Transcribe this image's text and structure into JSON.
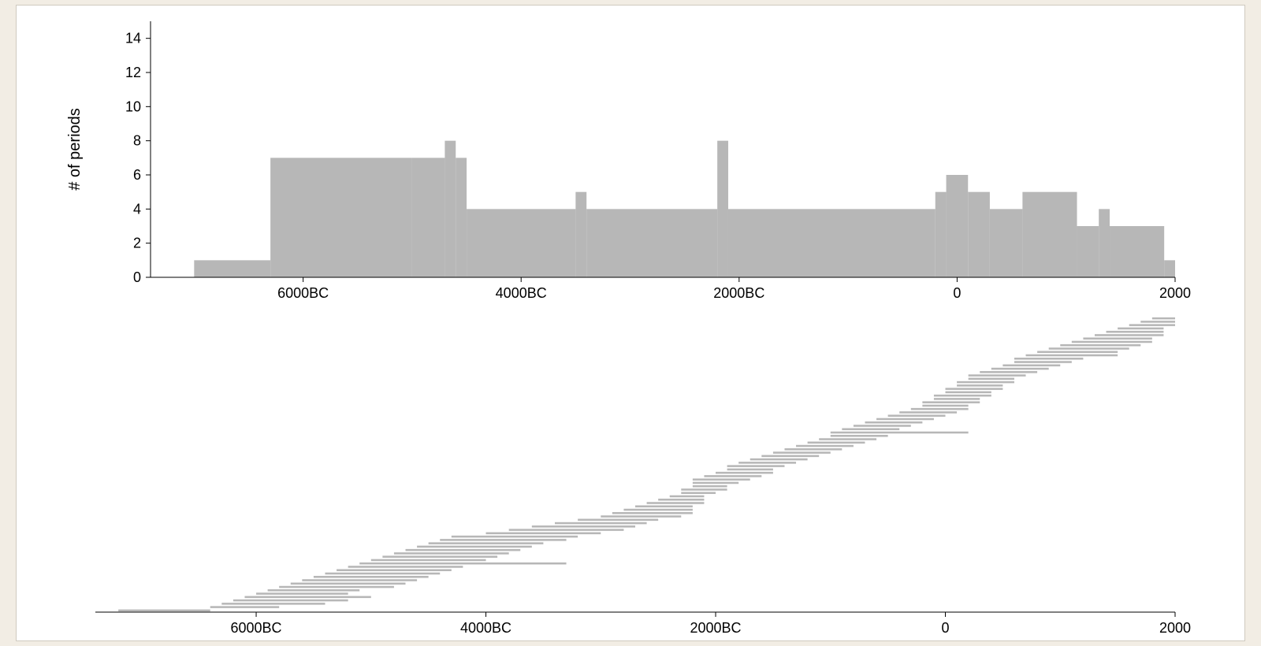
{
  "chart_data": [
    {
      "type": "bar",
      "title": "",
      "xlabel": "",
      "ylabel": "# of periods",
      "xlim": [
        -7400,
        2000
      ],
      "ylim": [
        0,
        15
      ],
      "x_ticks": [
        -6000,
        -4000,
        -2000,
        0,
        2000
      ],
      "x_tick_labels": [
        "6000BC",
        "4000BC",
        "2000BC",
        "0",
        "2000"
      ],
      "y_ticks": [
        0,
        2,
        4,
        6,
        8,
        10,
        12,
        14
      ],
      "bin_width": 100,
      "bins": [
        {
          "x0": -7000,
          "x1": -6300,
          "y": 1
        },
        {
          "x0": -6300,
          "x1": -5000,
          "y": 7
        },
        {
          "x0": -5000,
          "x1": -4700,
          "y": 7
        },
        {
          "x0": -4700,
          "x1": -4600,
          "y": 8
        },
        {
          "x0": -4600,
          "x1": -4500,
          "y": 7
        },
        {
          "x0": -4500,
          "x1": -3500,
          "y": 4
        },
        {
          "x0": -3500,
          "x1": -3400,
          "y": 5
        },
        {
          "x0": -3400,
          "x1": -2200,
          "y": 4
        },
        {
          "x0": -2200,
          "x1": -2100,
          "y": 8
        },
        {
          "x0": -2100,
          "x1": -200,
          "y": 4
        },
        {
          "x0": -200,
          "x1": -100,
          "y": 5
        },
        {
          "x0": -100,
          "x1": 100,
          "y": 6
        },
        {
          "x0": 100,
          "x1": 300,
          "y": 5
        },
        {
          "x0": 300,
          "x1": 600,
          "y": 4
        },
        {
          "x0": 600,
          "x1": 1100,
          "y": 5
        },
        {
          "x0": 1100,
          "x1": 1300,
          "y": 3
        },
        {
          "x0": 1300,
          "x1": 1400,
          "y": 4
        },
        {
          "x0": 1400,
          "x1": 1900,
          "y": 3
        },
        {
          "x0": 1900,
          "x1": 2000,
          "y": 1
        }
      ]
    },
    {
      "type": "gantt",
      "title": "",
      "xlabel": "",
      "ylabel": "",
      "xlim": [
        -7400,
        2000
      ],
      "x_ticks": [
        -6000,
        -4000,
        -2000,
        0,
        2000
      ],
      "x_tick_labels": [
        "6000BC",
        "4000BC",
        "2000BC",
        "0",
        "2000"
      ],
      "intervals": [
        {
          "start": -7200,
          "end": -6400
        },
        {
          "start": -6400,
          "end": -5800
        },
        {
          "start": -6300,
          "end": -5400
        },
        {
          "start": -6200,
          "end": -5200
        },
        {
          "start": -6100,
          "end": -5000
        },
        {
          "start": -6000,
          "end": -5200
        },
        {
          "start": -5900,
          "end": -5100
        },
        {
          "start": -5800,
          "end": -4800
        },
        {
          "start": -5700,
          "end": -4700
        },
        {
          "start": -5600,
          "end": -4600
        },
        {
          "start": -5500,
          "end": -4500
        },
        {
          "start": -5400,
          "end": -4400
        },
        {
          "start": -5300,
          "end": -4300
        },
        {
          "start": -5200,
          "end": -4200
        },
        {
          "start": -5100,
          "end": -3300
        },
        {
          "start": -5000,
          "end": -4000
        },
        {
          "start": -4900,
          "end": -3900
        },
        {
          "start": -4800,
          "end": -3800
        },
        {
          "start": -4700,
          "end": -3700
        },
        {
          "start": -4600,
          "end": -3600
        },
        {
          "start": -4500,
          "end": -3500
        },
        {
          "start": -4400,
          "end": -3300
        },
        {
          "start": -4300,
          "end": -3200
        },
        {
          "start": -4000,
          "end": -3000
        },
        {
          "start": -3800,
          "end": -2800
        },
        {
          "start": -3600,
          "end": -2700
        },
        {
          "start": -3400,
          "end": -2600
        },
        {
          "start": -3200,
          "end": -2500
        },
        {
          "start": -3000,
          "end": -2300
        },
        {
          "start": -2900,
          "end": -2200
        },
        {
          "start": -2800,
          "end": -2200
        },
        {
          "start": -2700,
          "end": -2200
        },
        {
          "start": -2600,
          "end": -2100
        },
        {
          "start": -2500,
          "end": -2100
        },
        {
          "start": -2400,
          "end": -2100
        },
        {
          "start": -2300,
          "end": -2000
        },
        {
          "start": -2300,
          "end": -1900
        },
        {
          "start": -2200,
          "end": -1900
        },
        {
          "start": -2200,
          "end": -1800
        },
        {
          "start": -2200,
          "end": -1700
        },
        {
          "start": -2100,
          "end": -1600
        },
        {
          "start": -2000,
          "end": -1500
        },
        {
          "start": -1900,
          "end": -1500
        },
        {
          "start": -1900,
          "end": -1400
        },
        {
          "start": -1800,
          "end": -1300
        },
        {
          "start": -1700,
          "end": -1200
        },
        {
          "start": -1600,
          "end": -1100
        },
        {
          "start": -1500,
          "end": -1000
        },
        {
          "start": -1400,
          "end": -900
        },
        {
          "start": -1300,
          "end": -800
        },
        {
          "start": -1200,
          "end": -700
        },
        {
          "start": -1100,
          "end": -600
        },
        {
          "start": -1000,
          "end": -500
        },
        {
          "start": -1000,
          "end": 200
        },
        {
          "start": -900,
          "end": -400
        },
        {
          "start": -800,
          "end": -300
        },
        {
          "start": -700,
          "end": -200
        },
        {
          "start": -600,
          "end": -100
        },
        {
          "start": -500,
          "end": 0
        },
        {
          "start": -400,
          "end": 100
        },
        {
          "start": -300,
          "end": 200
        },
        {
          "start": -200,
          "end": 200
        },
        {
          "start": -200,
          "end": 300
        },
        {
          "start": -100,
          "end": 300
        },
        {
          "start": -100,
          "end": 400
        },
        {
          "start": 0,
          "end": 400
        },
        {
          "start": 0,
          "end": 500
        },
        {
          "start": 100,
          "end": 500
        },
        {
          "start": 100,
          "end": 600
        },
        {
          "start": 200,
          "end": 600
        },
        {
          "start": 200,
          "end": 700
        },
        {
          "start": 300,
          "end": 800
        },
        {
          "start": 400,
          "end": 900
        },
        {
          "start": 500,
          "end": 1000
        },
        {
          "start": 600,
          "end": 1100
        },
        {
          "start": 600,
          "end": 1200
        },
        {
          "start": 700,
          "end": 1500
        },
        {
          "start": 800,
          "end": 1500
        },
        {
          "start": 900,
          "end": 1600
        },
        {
          "start": 1000,
          "end": 1700
        },
        {
          "start": 1100,
          "end": 1800
        },
        {
          "start": 1200,
          "end": 1800
        },
        {
          "start": 1300,
          "end": 1900
        },
        {
          "start": 1400,
          "end": 1900
        },
        {
          "start": 1500,
          "end": 1900
        },
        {
          "start": 1600,
          "end": 2000
        },
        {
          "start": 1700,
          "end": 2000
        },
        {
          "start": 1800,
          "end": 2000
        }
      ]
    }
  ]
}
